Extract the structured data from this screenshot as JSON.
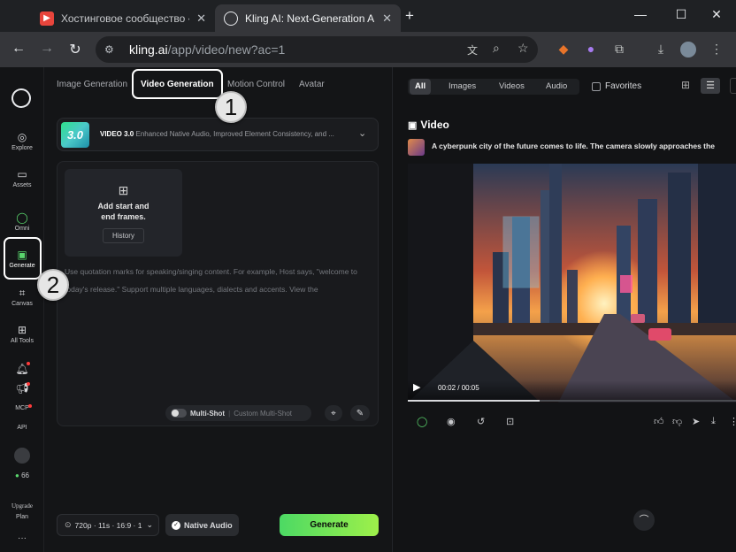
{
  "browser": {
    "tabs": [
      {
        "title": "Хостинговое сообщество «Tim",
        "active": false
      },
      {
        "title": "Kling AI: Next-Generation AI Cr",
        "active": true
      }
    ],
    "new_tab": "+",
    "url_host": "kling.ai",
    "url_path": "/app/video/new?ac=1"
  },
  "rail": {
    "items": [
      {
        "label": "Explore"
      },
      {
        "label": "Assets"
      },
      {
        "label": "Omni"
      },
      {
        "label": "Generate",
        "active": true
      },
      {
        "label": "Canvas"
      },
      {
        "label": "All Tools"
      },
      {
        "label": "MCP"
      },
      {
        "label": "API"
      },
      {
        "label": "66"
      },
      {
        "label": "Upgrade"
      },
      {
        "label": "Plan"
      }
    ]
  },
  "panel": {
    "mode_tabs": [
      "Image Generation",
      "Video Generation",
      "Motion Control",
      "Avatar"
    ],
    "active_mode": "Video Generation",
    "model": {
      "name": "VIDEO 3.0",
      "description": "Enhanced Native Audio, Improved Element Consistency, and ...",
      "thumb_text": "3.0"
    },
    "frames": {
      "title_line1": "Add start and",
      "title_line2": "end frames.",
      "history_label": "History"
    },
    "prompt_placeholder": "Use quotation marks for speaking/singing content. For example, Host says, \"welcome to today's release.\" Support multiple languages, dialects and accents. View the",
    "multishot": {
      "label": "Multi-Shot",
      "custom": "Custom Multi-Shot",
      "enabled": false
    },
    "settings_label": "720p · 11s · 16:9 · 1",
    "native_audio": {
      "label": "Native Audio",
      "checked": true
    },
    "generate_label": "Generate"
  },
  "right": {
    "filters": [
      "All",
      "Images",
      "Videos",
      "Audio"
    ],
    "active_filter": "All",
    "favorites_label": "Favorites",
    "section_title": "Video",
    "item_title": "A cyberpunk city of the future comes to life. The camera slowly approaches the",
    "video_time": "00:02 / 00:05",
    "progress": 0.4
  },
  "annotations": {
    "badge1": "1",
    "badge2": "2"
  }
}
